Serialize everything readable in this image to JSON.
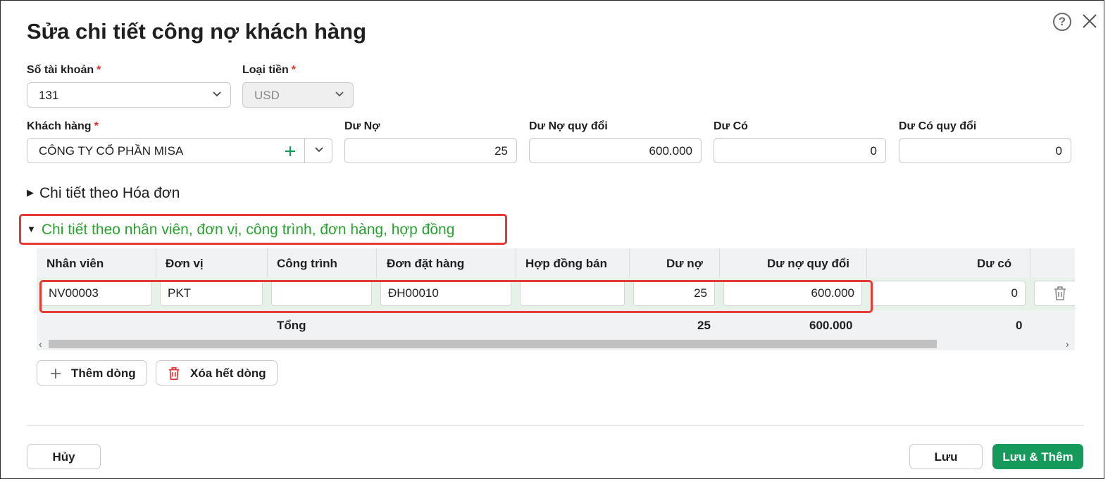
{
  "dialog": {
    "title": "Sửa chi tiết công nợ khách hàng"
  },
  "form": {
    "account_label": "Số tài khoản",
    "account_value": "131",
    "currency_label": "Loại tiền",
    "currency_value": "USD",
    "customer_label": "Khách hàng",
    "customer_value": "CÔNG TY CỔ PHẦN MISA",
    "debit_label": "Dư Nợ",
    "debit_value": "25",
    "debit_converted_label": "Dư Nợ quy đổi",
    "debit_converted_value": "600.000",
    "credit_label": "Dư Có",
    "credit_value": "0",
    "credit_converted_label": "Dư Có quy đổi",
    "credit_converted_value": "0",
    "required_mark": "*"
  },
  "sections": {
    "invoice": "Chi tiết theo Hóa đơn",
    "employee": "Chi tiết theo nhân viên, đơn vị, công trình, đơn hàng, hợp đồng"
  },
  "table": {
    "headers": [
      "Nhân viên",
      "Đơn vị",
      "Công trình",
      "Đơn đặt hàng",
      "Hợp đồng bán",
      "Dư nợ",
      "Dư nợ quy đổi",
      "Dư có"
    ],
    "row": [
      "NV00003",
      "PKT",
      "",
      "ĐH00010",
      "",
      "25",
      "600.000",
      "0"
    ],
    "total_label": "Tổng",
    "total_debit": "25",
    "total_debit_converted": "600.000",
    "total_credit": "0"
  },
  "actions": {
    "add_row": "Thêm dòng",
    "clear_rows": "Xóa hết dòng",
    "cancel": "Hủy",
    "save": "Lưu",
    "save_add": "Lưu & Thêm"
  },
  "colors": {
    "accent_green": "#159a5c",
    "section_green": "#2aa131",
    "highlight_red": "#e53935"
  }
}
